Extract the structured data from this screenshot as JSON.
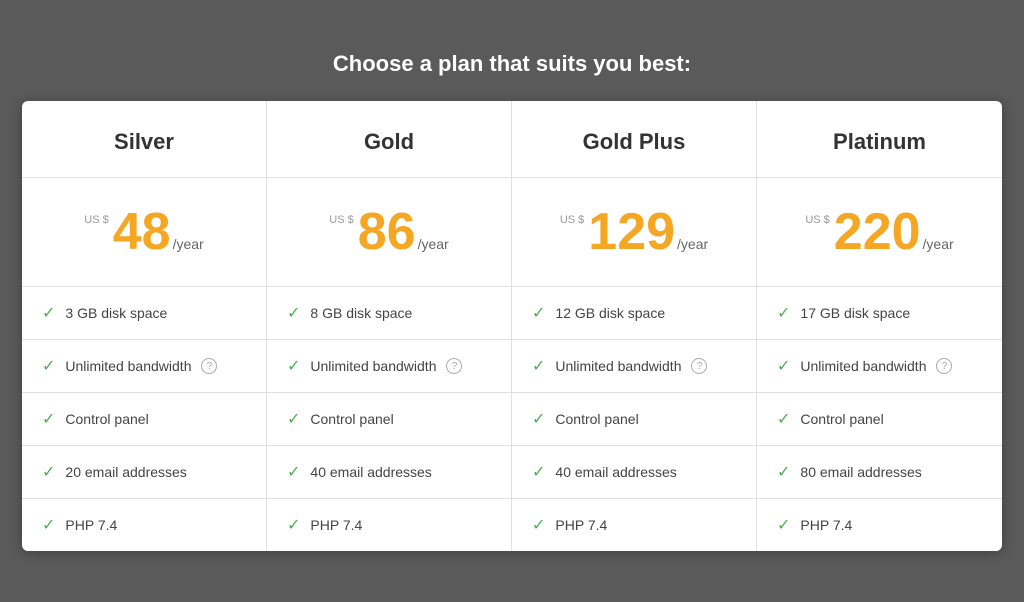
{
  "page": {
    "title": "Choose a plan that suits you best:"
  },
  "plans": [
    {
      "id": "silver",
      "name": "Silver",
      "currency": "US $",
      "price": "48",
      "period": "/year",
      "features": [
        {
          "text": "3 GB disk space",
          "hasInfo": false
        },
        {
          "text": "Unlimited bandwidth",
          "hasInfo": true
        },
        {
          "text": "Control panel",
          "hasInfo": false
        },
        {
          "text": "20 email addresses",
          "hasInfo": false
        },
        {
          "text": "PHP 7.4",
          "hasInfo": false
        }
      ]
    },
    {
      "id": "gold",
      "name": "Gold",
      "currency": "US $",
      "price": "86",
      "period": "/year",
      "features": [
        {
          "text": "8 GB disk space",
          "hasInfo": false
        },
        {
          "text": "Unlimited bandwidth",
          "hasInfo": true
        },
        {
          "text": "Control panel",
          "hasInfo": false
        },
        {
          "text": "40 email addresses",
          "hasInfo": false
        },
        {
          "text": "PHP 7.4",
          "hasInfo": false
        }
      ]
    },
    {
      "id": "gold-plus",
      "name": "Gold Plus",
      "currency": "US $",
      "price": "129",
      "period": "/year",
      "features": [
        {
          "text": "12 GB disk space",
          "hasInfo": false
        },
        {
          "text": "Unlimited bandwidth",
          "hasInfo": true
        },
        {
          "text": "Control panel",
          "hasInfo": false
        },
        {
          "text": "40 email addresses",
          "hasInfo": false
        },
        {
          "text": "PHP 7.4",
          "hasInfo": false
        }
      ]
    },
    {
      "id": "platinum",
      "name": "Platinum",
      "currency": "US $",
      "price": "220",
      "period": "/year",
      "features": [
        {
          "text": "17 GB disk space",
          "hasInfo": false
        },
        {
          "text": "Unlimited bandwidth",
          "hasInfo": true
        },
        {
          "text": "Control panel",
          "hasInfo": false
        },
        {
          "text": "80 email addresses",
          "hasInfo": false
        },
        {
          "text": "PHP 7.4",
          "hasInfo": false
        }
      ]
    }
  ],
  "icons": {
    "check": "✓",
    "info": "?"
  }
}
